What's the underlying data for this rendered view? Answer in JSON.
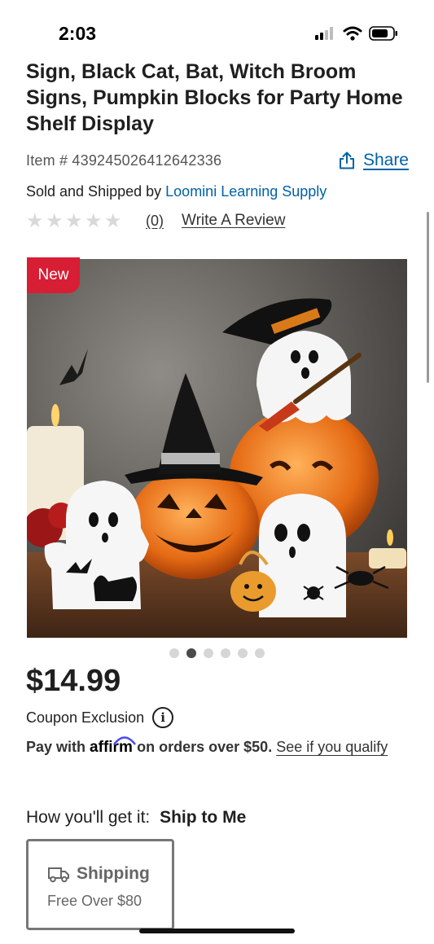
{
  "status_bar": {
    "time": "2:03"
  },
  "product": {
    "title": "Sign, Black Cat, Bat, Witch Broom Signs, Pumpkin Blocks for Party Home Shelf Display",
    "item_number": "Item # 439245026412642336",
    "share_label": "Share",
    "sold_prefix": "Sold and Shipped by",
    "seller": "Loomini Learning Supply",
    "rating_stars": 0,
    "review_count": "(0)",
    "write_review": "Write A Review",
    "badge": "New",
    "image_count": 6,
    "active_image": 1,
    "price": "$14.99",
    "coupon": "Coupon Exclusion"
  },
  "affirm": {
    "prefix": "Pay with",
    "logo": "affirm",
    "middle": "on orders over $50.",
    "link": "See if you qualify"
  },
  "fulfillment": {
    "label": "How you'll get it:",
    "method": "Ship to Me",
    "card_title": "Shipping",
    "card_sub": "Free Over $80"
  },
  "colors": {
    "link_blue": "#0061a8",
    "badge_red": "#d81e34",
    "text_dark": "#1f1f1f"
  },
  "icons": [
    "signal-icon",
    "wifi-icon",
    "battery-icon",
    "share-icon",
    "star-icon",
    "info-icon",
    "truck-icon"
  ]
}
